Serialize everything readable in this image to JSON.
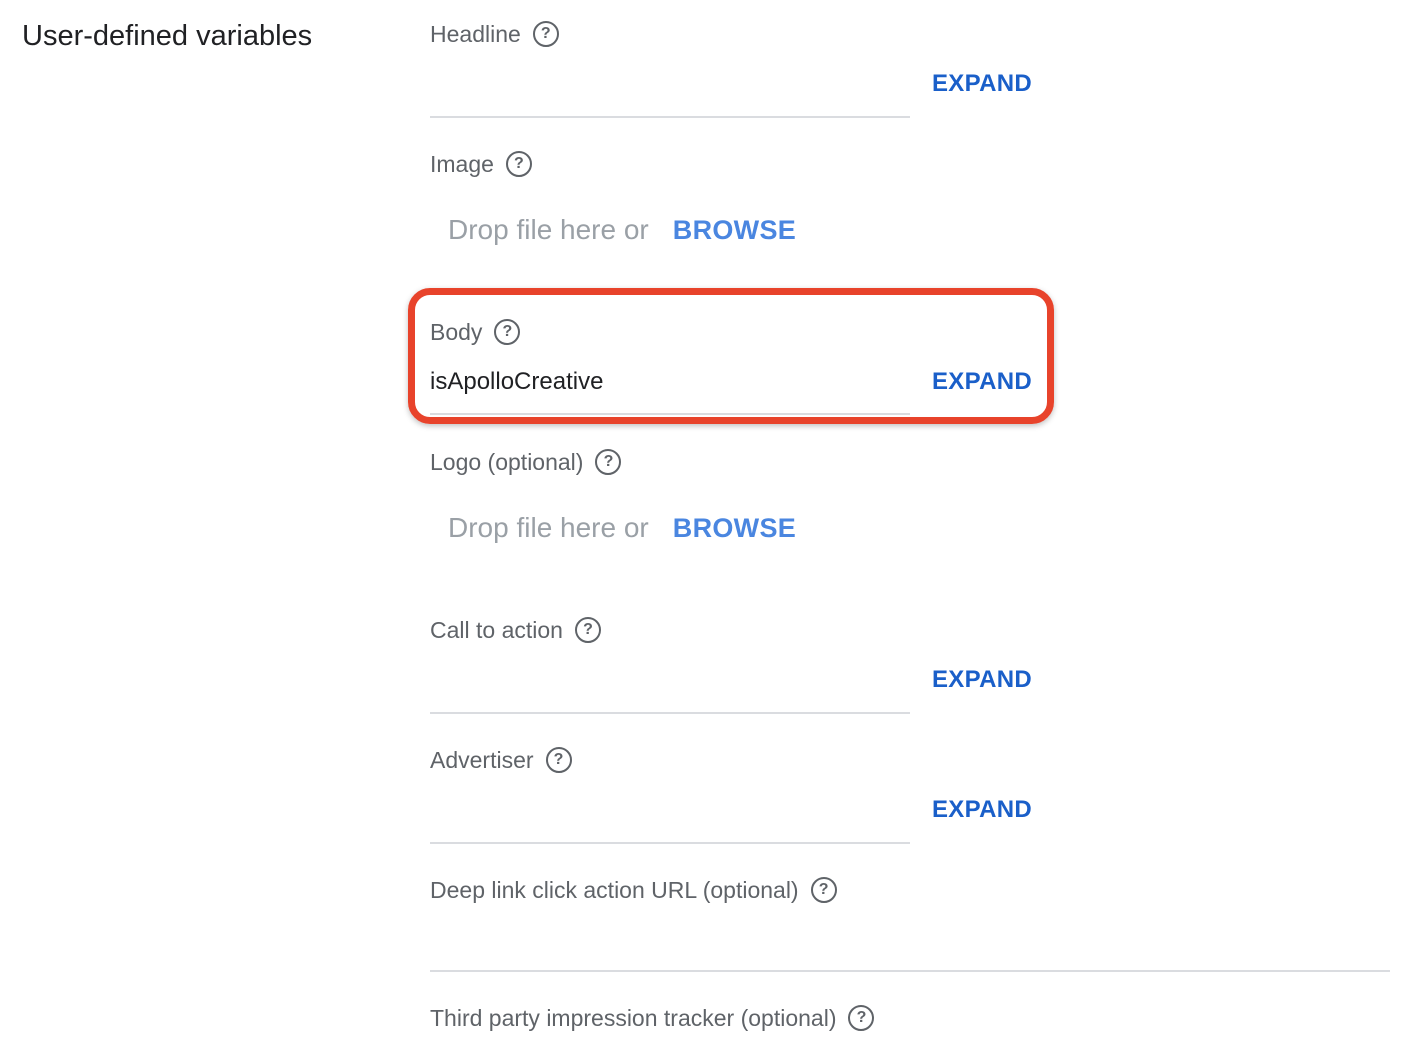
{
  "section": {
    "title": "User-defined variables"
  },
  "fields": {
    "headline": {
      "label": "Headline",
      "value": "",
      "expand_label": "EXPAND"
    },
    "image": {
      "label": "Image",
      "drop_text": "Drop file here or",
      "browse_label": "BROWSE"
    },
    "body": {
      "label": "Body",
      "value": "isApolloCreative",
      "expand_label": "EXPAND"
    },
    "logo": {
      "label": "Logo (optional)",
      "drop_text": "Drop file here or",
      "browse_label": "BROWSE"
    },
    "call_to_action": {
      "label": "Call to action",
      "value": "",
      "expand_label": "EXPAND"
    },
    "advertiser": {
      "label": "Advertiser",
      "value": "",
      "expand_label": "EXPAND"
    },
    "deep_link": {
      "label": "Deep link click action URL (optional)",
      "value": ""
    },
    "third_party_tracker": {
      "label": "Third party impression tracker (optional)"
    }
  },
  "icons": {
    "help": "help-circle-icon",
    "help_glyph": "?"
  },
  "colors": {
    "link_blue": "#1a5fc9",
    "browse_blue": "#4a86e0",
    "highlight_red": "#e8432b",
    "label_gray": "#5f6368",
    "placeholder_gray": "#9aa0a6",
    "divider": "#dadce0"
  }
}
